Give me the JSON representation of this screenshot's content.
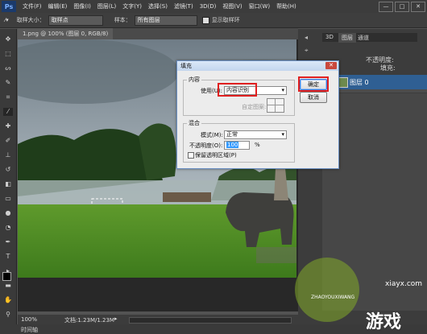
{
  "menu": {
    "logo": "Ps",
    "items": [
      "文件(F)",
      "编辑(E)",
      "图像(I)",
      "图层(L)",
      "文字(Y)",
      "选择(S)",
      "滤镜(T)",
      "3D(D)",
      "视图(V)",
      "窗口(W)",
      "帮助(H)"
    ],
    "window_buttons": [
      "—",
      "□",
      "✕"
    ]
  },
  "options": {
    "sample_size_label": "取样大小：",
    "sample_size_value": "取样点",
    "sample_label": "样本：",
    "sample_value": "所有图层",
    "show_ring_label": "显示取样环"
  },
  "document": {
    "tab": "1.png @ 100% (图层 0, RGB/8)",
    "zoom": "100%",
    "doc_info": "文档:1.23M/1.23M"
  },
  "bottom": {
    "label": "时间轴"
  },
  "panels": {
    "tabs": [
      "3D",
      "图层",
      "通道"
    ],
    "opacity_label": "不透明度:",
    "fill_label": "填充:",
    "layer_name": "图层 0"
  },
  "dialog": {
    "title": "填充",
    "close": "✕",
    "content_group": "内容",
    "use_label": "使用(U):",
    "use_value": "内容识别",
    "custom_pattern_label": "自定图案:",
    "blend_group": "混合",
    "mode_label": "模式(M):",
    "mode_value": "正常",
    "opacity_label": "不透明度(O):",
    "opacity_value": "100",
    "opacity_unit": "%",
    "preserve_label": "保留透明区域(P)",
    "ok": "确定",
    "cancel": "取消"
  },
  "watermark": {
    "text": "xiayx.com",
    "brand": "游戏",
    "sub": "ZHAOYOUXIWANG"
  },
  "colors": {
    "highlight": "#e02020",
    "dialog_bg": "#ececec",
    "app_bg": "#535353"
  }
}
